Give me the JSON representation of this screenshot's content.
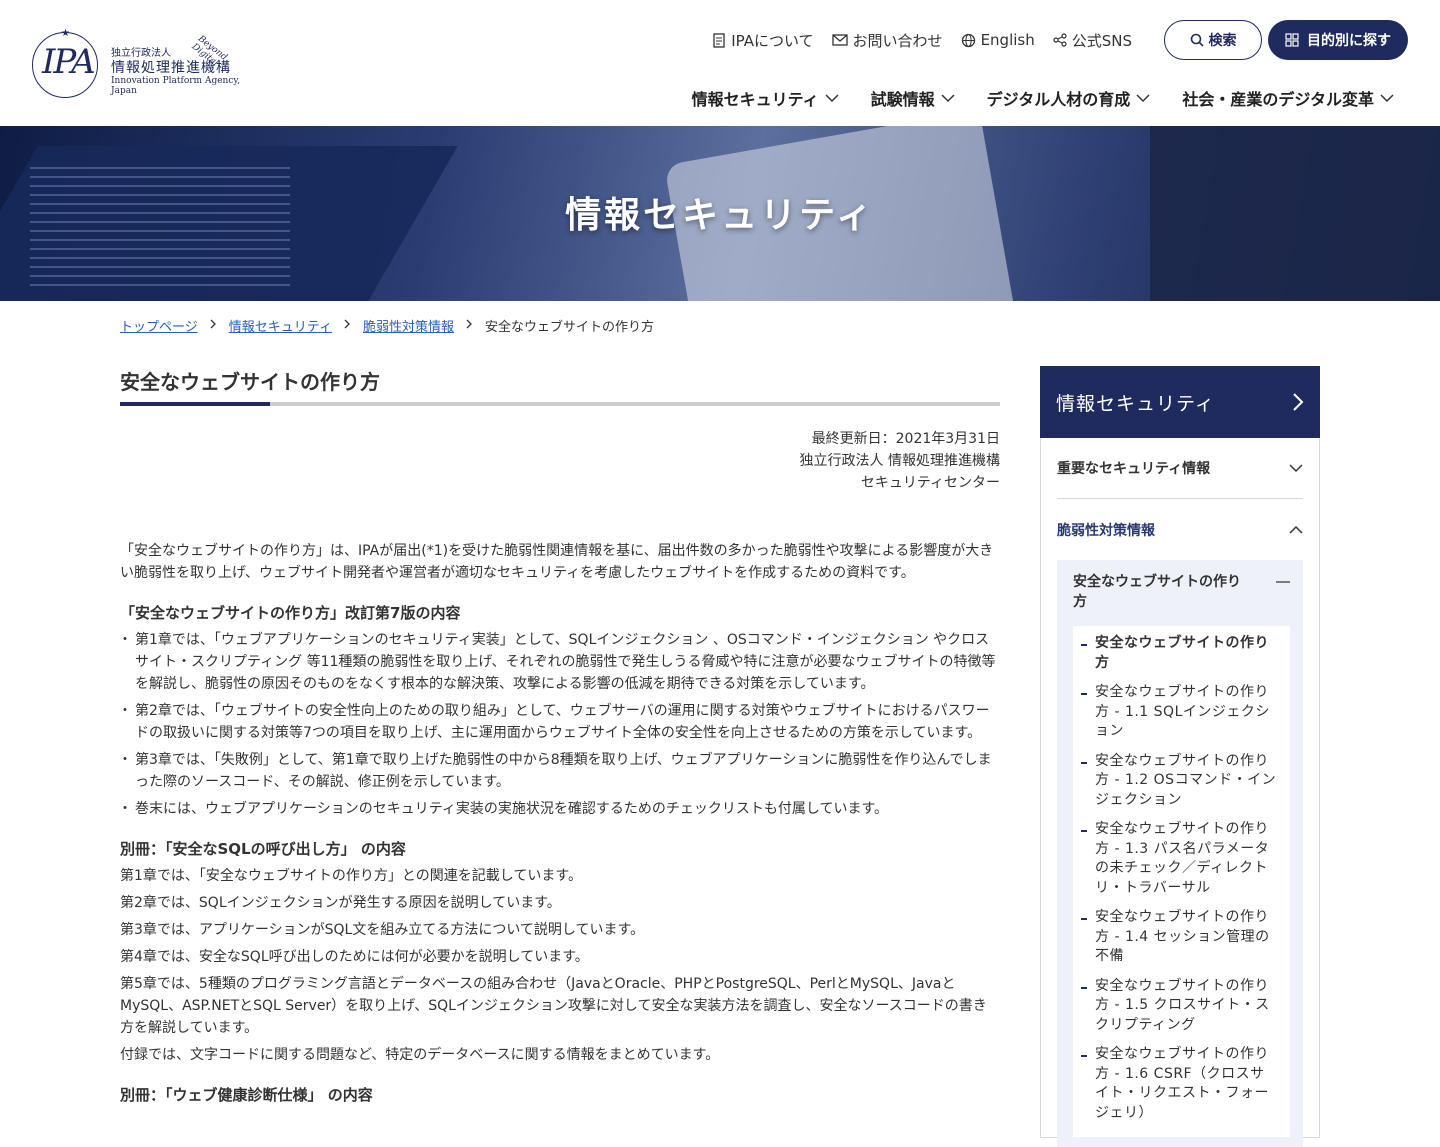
{
  "header": {
    "logo": {
      "org_small": "独立行政法人",
      "org_name": "情報処理推進機構",
      "org_en": "Innovation Platform Agency, Japan",
      "tagline": "Beyond Digital",
      "mark": "IPA"
    },
    "utility": {
      "about": "IPAについて",
      "contact": "お問い合わせ",
      "english": "English",
      "sns": "公式SNS",
      "search": "検索",
      "purpose": "目的別に探す"
    },
    "nav": [
      "情報セキュリティ",
      "試験情報",
      "デジタル人材の育成",
      "社会・産業のデジタル変革"
    ]
  },
  "hero": {
    "title": "情報セキュリティ"
  },
  "breadcrumb": {
    "items": [
      "トップページ",
      "情報セキュリティ",
      "脆弱性対策情報"
    ],
    "current": "安全なウェブサイトの作り方"
  },
  "article": {
    "title": "安全なウェブサイトの作り方",
    "updated": "最終更新日：2021年3月31日",
    "org": "独立行政法人 情報処理推進機構",
    "center": "セキュリティセンター",
    "intro": "「安全なウェブサイトの作り方」は、IPAが届出(*1)を受けた脆弱性関連情報を基に、届出件数の多かった脆弱性や攻撃による影響度が大きい脆弱性を取り上げ、ウェブサイト開発者や運営者が適切なセキュリティを考慮したウェブサイトを作成するための資料です。",
    "section1_title": "「安全なウェブサイトの作り方」改訂第7版の内容",
    "section1_items": [
      "第1章では、「ウェブアプリケーションのセキュリティ実装」として、SQLインジェクション 、OSコマンド・インジェクション やクロスサイト・スクリプティング 等11種類の脆弱性を取り上げ、それぞれの脆弱性で発生しうる脅威や特に注意が必要なウェブサイトの特徴等を解説し、脆弱性の原因そのものをなくす根本的な解決策、攻撃による影響の低減を期待できる対策を示しています。",
      "第2章では、「ウェブサイトの安全性向上のための取り組み」として、ウェブサーバの運用に関する対策やウェブサイトにおけるパスワードの取扱いに関する対策等7つの項目を取り上げ、主に運用面からウェブサイト全体の安全性を向上させるための方策を示しています。",
      "第3章では、「失敗例」として、第1章で取り上げた脆弱性の中から8種類を取り上げ、ウェブアプリケーションに脆弱性を作り込んでしまった際のソースコード、その解説、修正例を示しています。",
      "巻末には、ウェブアプリケーションのセキュリティ実装の実施状況を確認するためのチェックリストも付属しています。"
    ],
    "section2_title": "別冊：「安全なSQLの呼び出し方」 の内容",
    "section2_paras": [
      "第1章では、「安全なウェブサイトの作り方」との関連を記載しています。",
      "第2章では、SQLインジェクションが発生する原因を説明しています。",
      "第3章では、アプリケーションがSQL文を組み立てる方法について説明しています。",
      "第4章では、安全なSQL呼び出しのためには何が必要かを説明しています。",
      "第5章では、5種類のプログラミング言語とデータベースの組み合わせ（JavaとOracle、PHPとPostgreSQL、PerlとMySQL、JavaとMySQL、ASP.NETとSQL Server）を取り上げ、SQLインジェクション攻撃に対して安全な実装方法を調査し、安全なソースコードの書き方を解説しています。",
      "付録では、文字コードに関する問題など、特定のデータベースに関する情報をまとめています。"
    ],
    "section3_title": "別冊：「ウェブ健康診断仕様」 の内容"
  },
  "sidebar": {
    "title": "情報セキュリティ",
    "rows": [
      "重要なセキュリティ情報",
      "脆弱性対策情報"
    ],
    "sub_title": "安全なウェブサイトの作り方",
    "sub_items": [
      "安全なウェブサイトの作り方",
      "安全なウェブサイトの作り方 - 1.1 SQLインジェクション",
      "安全なウェブサイトの作り方 - 1.2 OSコマンド・インジェクション",
      "安全なウェブサイトの作り方 - 1.3 パス名パラメータの未チェック／ディレクトリ・トラバーサル",
      "安全なウェブサイトの作り方 - 1.4 セッション管理の不備",
      "安全なウェブサイトの作り方 - 1.5 クロスサイト・スクリプティング",
      "安全なウェブサイトの作り方 - 1.6 CSRF（クロスサイト・リクエスト・フォージェリ）"
    ]
  },
  "colors": {
    "brand": "#1f2a5e",
    "link": "#2a5cb8",
    "sub_bg": "#eef1f8"
  }
}
